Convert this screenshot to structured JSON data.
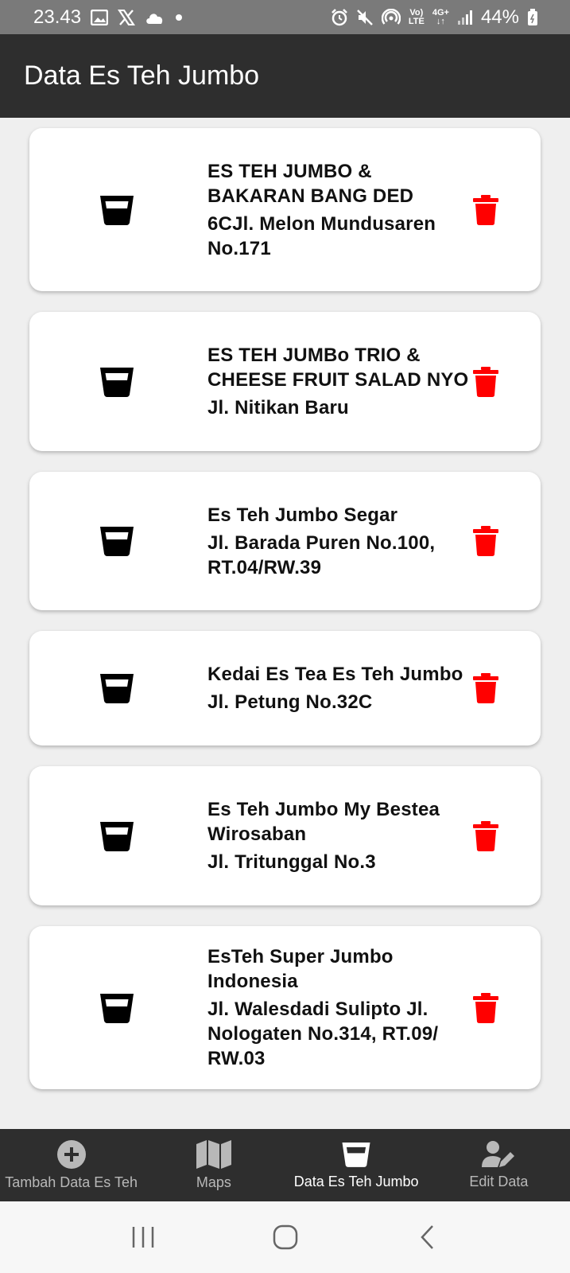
{
  "status_bar": {
    "time": "23.43",
    "battery": "44%",
    "volte": "Vo)\nLTE",
    "network": "4G+"
  },
  "app_bar": {
    "title": "Data Es Teh Jumbo"
  },
  "items": [
    {
      "title": "ES TEH JUMBO & BAKARAN BANG DED",
      "address": "6CJl. Melon Mundusaren No.171"
    },
    {
      "title": "ES TEH JUMBo TRIO & CHEESE FRUIT SALAD NYO",
      "address": "Jl. Nitikan Baru"
    },
    {
      "title": "Es Teh Jumbo Segar",
      "address": "Jl. Barada Puren No.100, RT.04/RW.39"
    },
    {
      "title": "Kedai Es Tea Es Teh Jumbo",
      "address": "Jl. Petung No.32C"
    },
    {
      "title": "Es Teh Jumbo My Bestea Wirosaban",
      "address": "Jl. Tritunggal No.3"
    },
    {
      "title": "EsTeh Super Jumbo Indonesia",
      "address": "Jl. Walesdadi Sulipto Jl. Nologaten No.314, RT.09/ RW.03"
    }
  ],
  "bottom_nav": [
    {
      "label": "Tambah Data Es Teh",
      "icon": "add-circle-icon"
    },
    {
      "label": "Maps",
      "icon": "map-icon"
    },
    {
      "label": "Data Es Teh Jumbo",
      "icon": "glass-icon",
      "active": true
    },
    {
      "label": "Edit Data",
      "icon": "user-edit-icon"
    }
  ],
  "colors": {
    "app_bar": "#2e2e2e",
    "delete": "#ff0000",
    "status_bar": "#7a7a7a"
  }
}
